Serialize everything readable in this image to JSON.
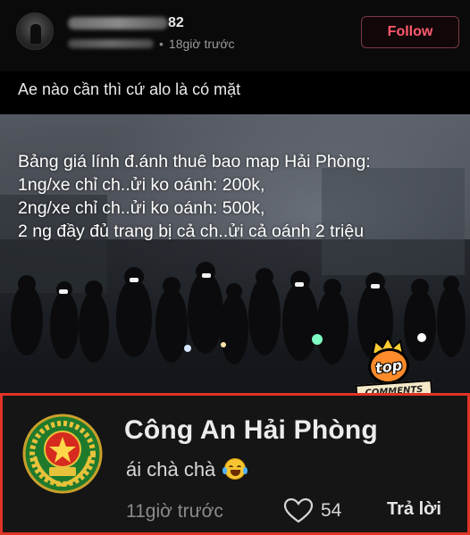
{
  "post": {
    "username_visible_suffix": "82",
    "timestamp": "18giờ trước",
    "follow_label": "Follow",
    "caption": "Ae nào cần thì cứ alo là có mặt"
  },
  "photo": {
    "overlay_lines": [
      "Bảng giá lính đ.ánh thuê bao map Hải Phòng:",
      "1ng/xe chỉ ch..ửi ko oánh: 200k,",
      "2ng/xe chỉ ch..ửi ko oánh: 500k,",
      "2 ng đầy đủ trang bị cả ch..ửi cả oánh 2 triệu"
    ]
  },
  "badge": {
    "top_label": "top",
    "comments_label": "COMMENTS"
  },
  "comment": {
    "author": "Công An Hải Phòng",
    "text": "ái chà chà",
    "emoji_icon": "face-with-tears-of-joy-icon",
    "time": "11giờ trước",
    "likes": "54",
    "reply_label": "Trả lời"
  },
  "colors": {
    "follow_text": "#ff5a6e",
    "card_border": "#e03426",
    "badge_orange": "#ff8b2a"
  }
}
